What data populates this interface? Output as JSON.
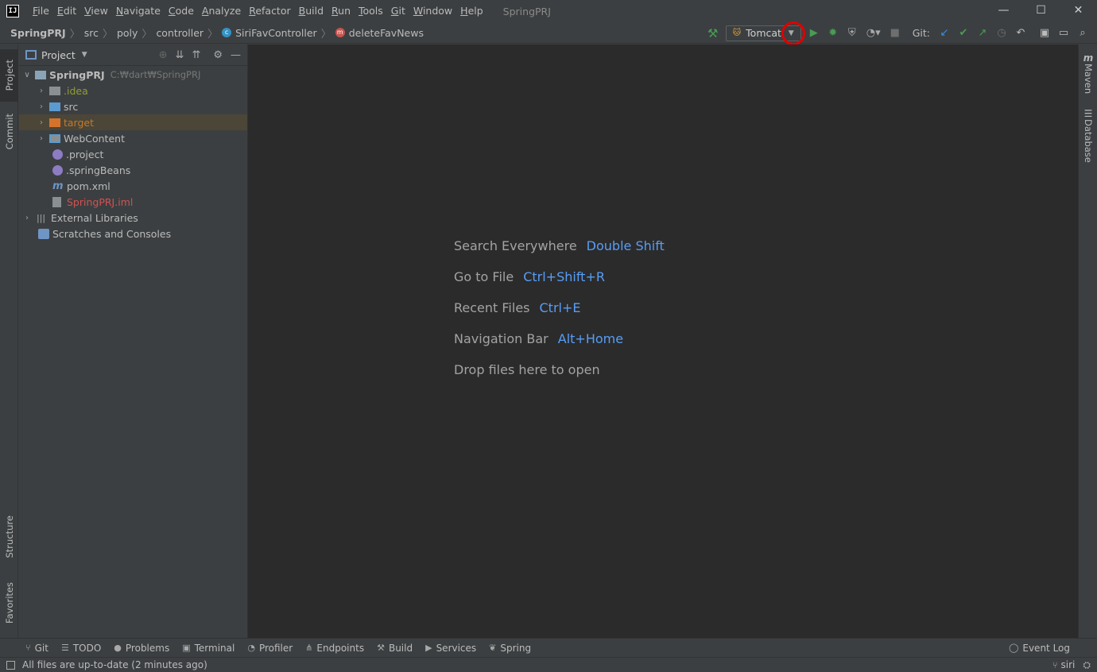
{
  "app": {
    "logo": "IJ",
    "window_title": "SpringPRJ"
  },
  "menu": [
    "File",
    "Edit",
    "View",
    "Navigate",
    "Code",
    "Analyze",
    "Refactor",
    "Build",
    "Run",
    "Tools",
    "Git",
    "Window",
    "Help"
  ],
  "window_controls": {
    "minimize": "—",
    "maximize": "☐",
    "close": "✕"
  },
  "breadcrumb": {
    "project": "SpringPRJ",
    "src": "src",
    "poly": "poly",
    "controller": "controller",
    "class": "SiriFavController",
    "method": "deleteFavNews"
  },
  "toolbar": {
    "run_config": "Tomcat",
    "git_label": "Git:"
  },
  "stripes": {
    "left_top": [
      "Project",
      "Commit"
    ],
    "left_bottom": [
      "Structure",
      "Favorites"
    ],
    "right": [
      "Maven",
      "Database"
    ]
  },
  "project_panel": {
    "title": "Project",
    "tree": [
      {
        "name": "SpringPRJ",
        "hint": "C:₩dart₩SpringPRJ",
        "color": "#bbbbbb"
      },
      {
        "name": ".idea",
        "color": "#8f9d3a"
      },
      {
        "name": "src",
        "color": "#bbbbbb"
      },
      {
        "name": "target",
        "color": "#c37a2f"
      },
      {
        "name": "WebContent",
        "color": "#bbbbbb"
      },
      {
        "name": ".project",
        "color": "#bbbbbb"
      },
      {
        "name": ".springBeans",
        "color": "#bbbbbb"
      },
      {
        "name": "pom.xml",
        "color": "#bbbbbb"
      },
      {
        "name": "SpringPRJ.iml",
        "color": "#d25252"
      },
      {
        "name": "External Libraries",
        "color": "#bbbbbb"
      },
      {
        "name": "Scratches and Consoles",
        "color": "#bbbbbb"
      }
    ]
  },
  "editor_hints": [
    {
      "label": "Search Everywhere",
      "key": "Double Shift"
    },
    {
      "label": "Go to File",
      "key": "Ctrl+Shift+R"
    },
    {
      "label": "Recent Files",
      "key": "Ctrl+E"
    },
    {
      "label": "Navigation Bar",
      "key": "Alt+Home"
    },
    {
      "label": "Drop files here to open",
      "key": ""
    }
  ],
  "bottom_tabs": [
    "Git",
    "TODO",
    "Problems",
    "Terminal",
    "Profiler",
    "Endpoints",
    "Build",
    "Services",
    "Spring"
  ],
  "event_log": "Event Log",
  "status": {
    "message": "All files are up-to-date (2 minutes ago)",
    "branch": "siri"
  },
  "colors": {
    "editor_bg": "#2b2b2b",
    "panel_bg": "#3c3f41",
    "accent_blue": "#589df6",
    "run_green": "#499c54",
    "highlight_ring": "#e00000"
  }
}
